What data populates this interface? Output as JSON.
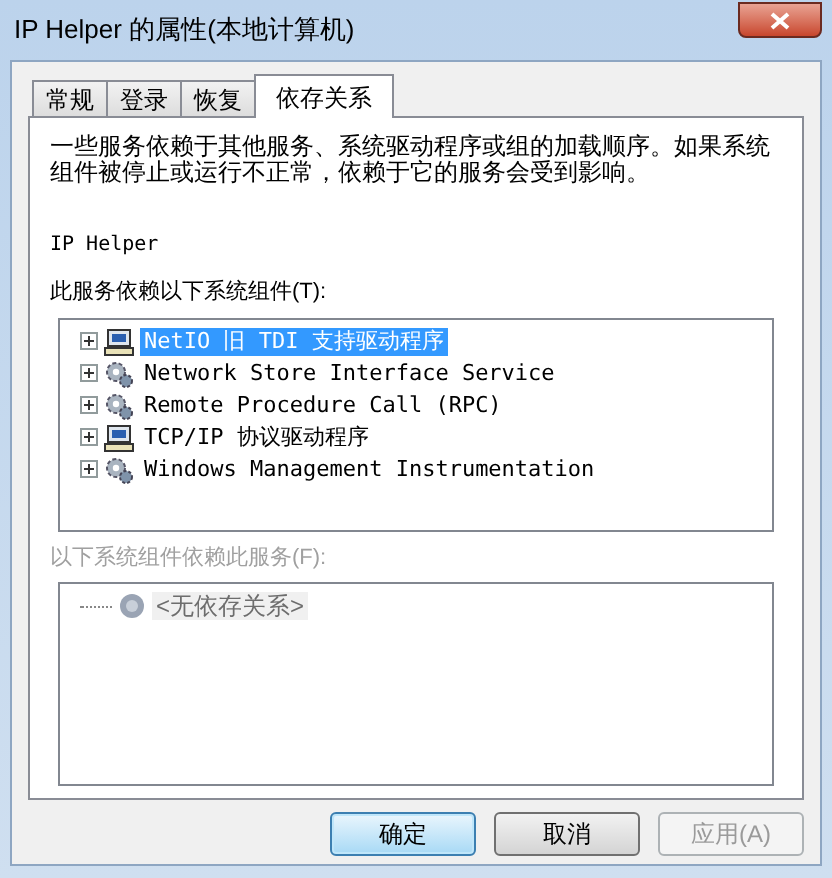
{
  "window": {
    "title": "IP Helper 的属性(本地计算机)"
  },
  "tabs": [
    {
      "label": "常规",
      "selected": false
    },
    {
      "label": "登录",
      "selected": false
    },
    {
      "label": "恢复",
      "selected": false
    },
    {
      "label": "依存关系",
      "selected": true
    }
  ],
  "description": "一些服务依赖于其他服务、系统驱动程序或组的加载顺序。如果系统组件被停止或运行不正常，依赖于它的服务会受到影响。",
  "service_name": "IP Helper",
  "depends_on": {
    "label": "此服务依赖以下系统组件(T):",
    "disabled": false,
    "items": [
      {
        "kind": "driver",
        "label": "NetIO 旧 TDI 支持驱动程序",
        "selected": true
      },
      {
        "kind": "service",
        "label": "Network Store Interface Service",
        "selected": false
      },
      {
        "kind": "service",
        "label": "Remote Procedure Call (RPC)",
        "selected": false
      },
      {
        "kind": "driver",
        "label": "TCP/IP 协议驱动程序",
        "selected": false
      },
      {
        "kind": "service",
        "label": "Windows Management Instrumentation",
        "selected": false
      }
    ]
  },
  "dependents": {
    "label": "以下系统组件依赖此服务(F):",
    "disabled": true,
    "items": [
      {
        "kind": "none",
        "label": "<无依存关系>",
        "selected": false
      }
    ]
  },
  "buttons": [
    {
      "label": "确定",
      "default": true,
      "disabled": false
    },
    {
      "label": "取消",
      "default": false,
      "disabled": false
    },
    {
      "label": "应用(A)",
      "default": false,
      "disabled": true
    }
  ]
}
